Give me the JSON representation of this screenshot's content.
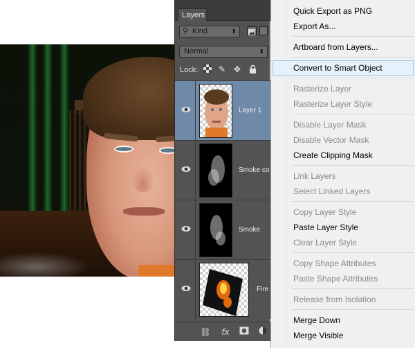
{
  "layers_panel": {
    "tab_label": "Layers",
    "filter": {
      "value": "Kind",
      "icons": [
        "image-filter-icon",
        "adjustment-filter-icon"
      ]
    },
    "blend_mode": "Normal",
    "lock_label": "Lock:",
    "lock_icons": [
      "lock-transparent-pixels-icon",
      "lock-image-pixels-icon",
      "lock-position-icon",
      "lock-all-icon"
    ],
    "layers": [
      {
        "name": "Layer 1",
        "selected": true,
        "visible": true,
        "thumb": "face"
      },
      {
        "name": "Smoke co",
        "selected": false,
        "visible": true,
        "thumb": "smoke"
      },
      {
        "name": "Smoke",
        "selected": false,
        "visible": true,
        "thumb": "smoke"
      },
      {
        "name": "Fire",
        "selected": false,
        "visible": true,
        "thumb": "fire"
      }
    ],
    "footer_icons": [
      "link-layers-icon",
      "layer-style-fx-icon",
      "add-mask-icon",
      "adjustment-layer-icon"
    ]
  },
  "context_menu": {
    "items": [
      {
        "label": "Quick Export as PNG",
        "enabled": true
      },
      {
        "label": "Export As...",
        "enabled": true
      },
      {
        "separator": true
      },
      {
        "label": "Artboard from Layers...",
        "enabled": true
      },
      {
        "separator": true
      },
      {
        "label": "Convert to Smart Object",
        "enabled": true,
        "hover": true
      },
      {
        "separator": true
      },
      {
        "label": "Rasterize Layer",
        "enabled": false
      },
      {
        "label": "Rasterize Layer Style",
        "enabled": false
      },
      {
        "separator": true
      },
      {
        "label": "Disable Layer Mask",
        "enabled": false
      },
      {
        "label": "Disable Vector Mask",
        "enabled": false
      },
      {
        "label": "Create Clipping Mask",
        "enabled": true
      },
      {
        "separator": true
      },
      {
        "label": "Link Layers",
        "enabled": false
      },
      {
        "label": "Select Linked Layers",
        "enabled": false
      },
      {
        "separator": true
      },
      {
        "label": "Copy Layer Style",
        "enabled": false
      },
      {
        "label": "Paste Layer Style",
        "enabled": true
      },
      {
        "label": "Clear Layer Style",
        "enabled": false
      },
      {
        "separator": true
      },
      {
        "label": "Copy Shape Attributes",
        "enabled": false
      },
      {
        "label": "Paste Shape Attributes",
        "enabled": false
      },
      {
        "separator": true
      },
      {
        "label": "Release from Isolation",
        "enabled": false
      },
      {
        "separator": true
      },
      {
        "label": "Merge Down",
        "enabled": true
      },
      {
        "label": "Merge Visible",
        "enabled": true
      }
    ]
  }
}
